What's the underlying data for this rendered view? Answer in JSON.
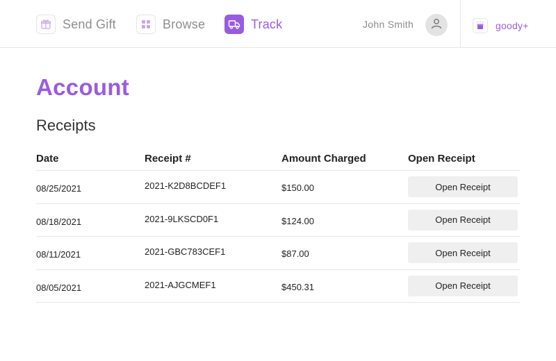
{
  "nav": {
    "items": [
      {
        "label": "Send Gift",
        "icon": "gift-icon",
        "active": false
      },
      {
        "label": "Browse",
        "icon": "grid-icon",
        "active": false
      },
      {
        "label": "Track",
        "icon": "truck-icon",
        "active": true
      }
    ],
    "user_name": "John Smith",
    "brand": "goody+"
  },
  "page": {
    "title": "Account",
    "section_title": "Receipts"
  },
  "table": {
    "headers": [
      "Date",
      "Receipt #",
      "Amount Charged",
      "Open Receipt"
    ],
    "rows": [
      {
        "date": "08/25/2021",
        "receipt": "2021-K2D8BCDEF1",
        "amount": "$150.00",
        "button": "Open Receipt"
      },
      {
        "date": "08/18/2021",
        "receipt": "2021-9LKSCD0F1",
        "amount": "$124.00",
        "button": "Open Receipt"
      },
      {
        "date": "08/11/2021",
        "receipt": "2021-GBC783CEF1",
        "amount": "$87.00",
        "button": "Open Receipt"
      },
      {
        "date": "08/05/2021",
        "receipt": "2021-AJGCMEF1",
        "amount": "$450.31",
        "button": "Open Receipt"
      }
    ]
  },
  "colors": {
    "accent": "#9a5be0",
    "muted_text": "#8d8d8d",
    "divider": "#e6e6e6",
    "button_bg": "#efefef"
  }
}
